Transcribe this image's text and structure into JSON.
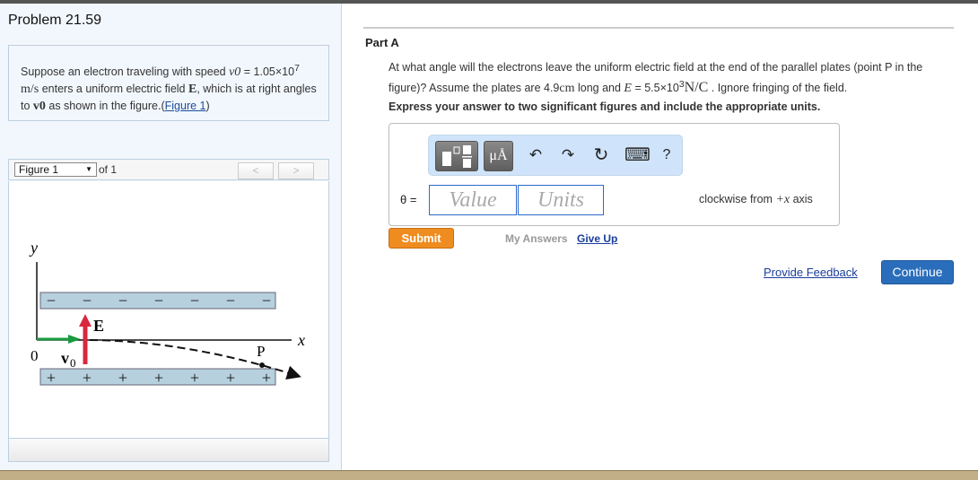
{
  "problem": {
    "title": "Problem 21.59",
    "text_1": "Suppose an electron traveling with speed ",
    "v0_symbol": "v0",
    "text_2": " = 1.05×10",
    "exp_7": "7",
    "unit_ms": "m/s",
    "text_3": " enters a uniform electric field ",
    "E_symbol": "E",
    "text_4": ", which is at right angles to ",
    "v0_vec": "v0",
    "text_5": " as shown in the figure.(",
    "figure_link": "Figure 1",
    "text_6": ")"
  },
  "figure": {
    "selector": "Figure 1",
    "of_label": "of 1",
    "prev": "<",
    "next": ">",
    "labels": {
      "y": "y",
      "x": "x",
      "origin": "0",
      "E": "E",
      "v0": "v",
      "v0_sub": "0",
      "P": "P",
      "minus": "−",
      "plus": "+"
    }
  },
  "partA": {
    "heading": "Part A",
    "q1": "At what angle will the electrons leave the uniform electric field at the end of the parallel plates (point P in the figure)? Assume the plates are 4.9",
    "cm": "cm",
    "q2": " long and ",
    "E": "E",
    "q3": " = 5.5×10",
    "exp_3": "3",
    "NC": "N/C",
    "q4": " . Ignore fringing of the field.",
    "express": "Express your answer to two significant figures and include the appropriate units.",
    "toolbar": {
      "units_btn": "μÅ",
      "undo": "↶",
      "redo": "↷",
      "reset": "↻",
      "keyboard": "⌨",
      "help": "?"
    },
    "theta_label": "θ =",
    "value_placeholder": "Value",
    "units_placeholder": "Units",
    "suffix_1": "clockwise from ",
    "suffix_x": "+x",
    "suffix_2": " axis",
    "submit": "Submit",
    "my_answers": "My Answers",
    "give_up": "Give Up"
  },
  "footer": {
    "feedback": "Provide Feedback",
    "continue": "Continue"
  }
}
